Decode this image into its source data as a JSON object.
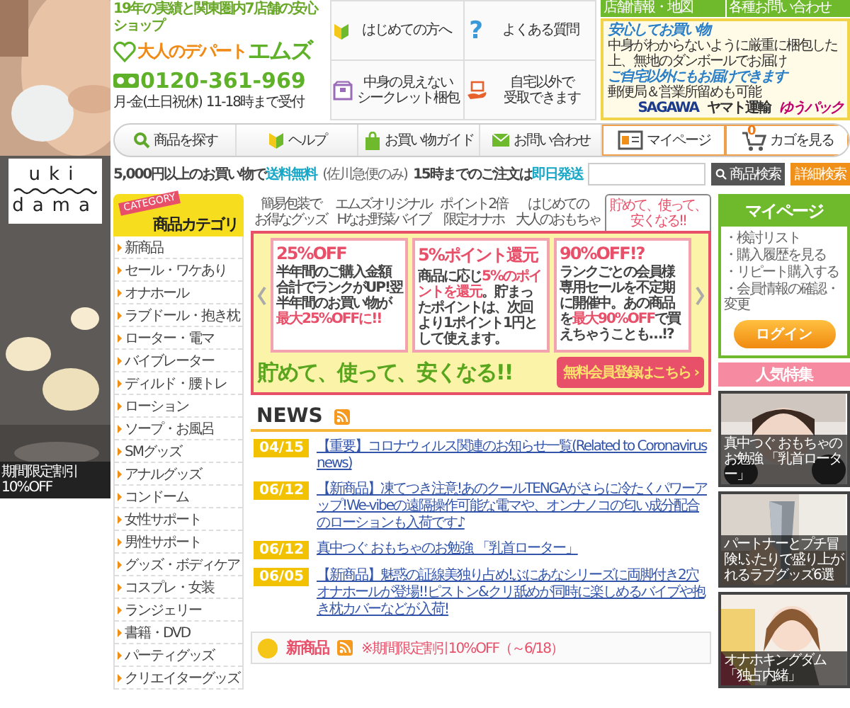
{
  "left_banner": {
    "brand": [
      "uki",
      "dama"
    ],
    "caption": "期間限定割引10%OFF"
  },
  "header": {
    "tagline": "19年の実績と関東圏内7店舗の安心ショップ",
    "logo": [
      "大人のデパート",
      "エムズ"
    ],
    "phone": "0120-361-969",
    "hours": [
      "月-金(土日祝休)",
      "11-18時まで受付"
    ],
    "info": [
      {
        "kind": "leaf",
        "lines": [
          "はじめての方へ"
        ]
      },
      {
        "kind": "question",
        "symbol": "?",
        "lines": [
          "よくある質問"
        ]
      },
      {
        "kind": "box",
        "lines": [
          "中身の見えない",
          "シークレット梱包"
        ]
      },
      {
        "kind": "hand",
        "lines": [
          "自宅以外で",
          "受取できます"
        ]
      }
    ],
    "top_links": [
      "店舗情報・地図",
      "各種お問い合わせ"
    ],
    "delivery": [
      {
        "title": "安心してお買い物",
        "note": "中身がわからないように厳重に梱包した上、無地のダンボールでお届け"
      },
      {
        "title": "ご自宅以外にもお届けできます",
        "note": "郵便局＆営業所留めも可能"
      }
    ],
    "carriers": [
      "SAGAWA",
      "ヤマト運輸",
      "ゆうパック"
    ]
  },
  "nav": [
    {
      "kind": "search",
      "label": "商品を探す"
    },
    {
      "kind": "leaf",
      "label": "ヘルプ"
    },
    {
      "kind": "bag",
      "label": "お買い物ガイド"
    },
    {
      "kind": "mail",
      "label": "お問い合わせ"
    },
    {
      "kind": "mypage",
      "label": "マイページ"
    },
    {
      "kind": "cart",
      "label": "カゴを見る",
      "count": "0"
    }
  ],
  "notice": {
    "shipping": "5,000円以上のお買い物で**送料無料**",
    "shipping_note": "(佐川急便のみ)",
    "same_day": "15時までのご注文は**即日発送**"
  },
  "search": {
    "buttons": [
      "商品検索",
      "詳細検索"
    ]
  },
  "categories": {
    "badge": "CATEGORY",
    "title": "商品カテゴリ",
    "items": [
      "新商品",
      "セール・ワケあり",
      "オナホール",
      "ラブドール・抱き枕",
      "ローター・電マ",
      "バイブレーター",
      "ディルド・腰トレ",
      "ローション",
      "ソープ・お風呂",
      "SMグッズ",
      "アナルグッズ",
      "コンドーム",
      "女性サポート",
      "男性サポート",
      "グッズ・ボディケア",
      "コスプレ・女装",
      "ランジェリー",
      "書籍・DVD",
      "パーティグッズ",
      "クリエイターグッズ"
    ]
  },
  "feature_tabs": [
    {
      "lines": [
        "簡易包装で",
        "お得なグッズ"
      ],
      "selected": false
    },
    {
      "lines": [
        "エムズオリジナル",
        "Hなお野菜バイブ"
      ],
      "selected": false
    },
    {
      "lines": [
        "ポイント2倍",
        "限定オナホ"
      ],
      "selected": false
    },
    {
      "lines": [
        "はじめての",
        "大人のおもちゃ"
      ],
      "selected": false
    },
    {
      "lines": [
        "貯めて、使って、",
        "安くなる!!"
      ],
      "selected": true
    }
  ],
  "promo": {
    "panels": [
      {
        "headline": "25%OFF",
        "text": "半年間のご購入金額合計でランクがUP!翌半年間のお買い物が**最大25%OFFに!!**"
      },
      {
        "headline": "5%ポイント還元",
        "text": "商品に応じ**5%のポイントを還元**。貯まったポイントは、次回より1ポイント1円として使えます。"
      },
      {
        "headline": "90%OFF!?",
        "text": "ランクごとの会員様専用セールを不定期に開催中。あの商品を**最大90%OFF**で買えちゃうことも…!?"
      }
    ],
    "slogan": "貯めて、使って、安くなる!!",
    "cta": "無料会員登録はこちら ›"
  },
  "news": {
    "title": "NEWS",
    "items": [
      {
        "date": "04/15",
        "text": "【重要】コロナウィルス関連のお知らせ一覧(Related to Coronavirus news)"
      },
      {
        "date": "06/12",
        "text": "【新商品】凍てつき注意!あのクールTENGAがさらに冷たくパワーアップ!We-vibeの遠隔操作可能な電マや、オンナノコの匂い成分配合のローションも入荷です♪"
      },
      {
        "date": "06/12",
        "text": "真中つぐ おもちゃのお勉強 「乳首ローター」"
      },
      {
        "date": "06/05",
        "text": "【新商品】魅惑の証線美独り占め!ぶにあなシリーズに両脚付き2穴オナホールが登場!!ピストン&クリ舐めが同時に楽しめるバイブや抱き枕カバーなどが入荷!"
      }
    ]
  },
  "new_products": {
    "title": "新商品",
    "note": "※期間限定割引10%OFF（～6/18）"
  },
  "mypage": {
    "title": "マイページ",
    "links": [
      "・検討リスト",
      "・購入履歴を見る",
      "・リピート購入する",
      "・会員情報の確認・変更"
    ],
    "login": "ログイン"
  },
  "featured": {
    "title": "人気特集",
    "cards": [
      {
        "caption": "真中つぐ おもちゃのお勉強 「乳首ローター」"
      },
      {
        "caption": "パートナーとプチ冒険!ふたりで盛り上がれるラブグッズ6選"
      },
      {
        "caption": "オナホキングダム「独占内緒」"
      }
    ]
  }
}
